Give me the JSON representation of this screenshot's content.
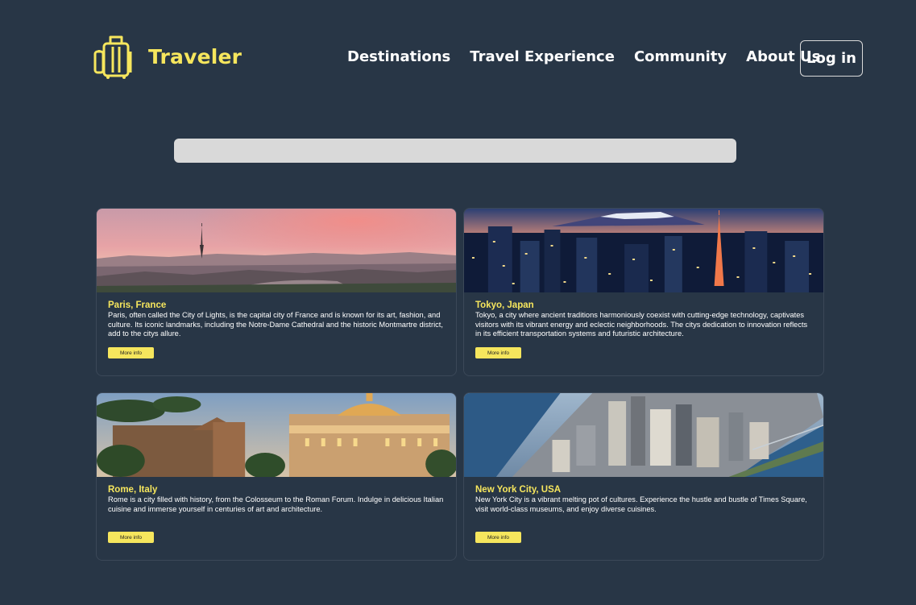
{
  "brand": {
    "name": "Traveler",
    "icon": "luggage-icon",
    "color": "#f6e65d"
  },
  "nav": {
    "destinations": "Destinations",
    "travel_experience": "Travel Experience",
    "community": "Community",
    "about_us": "About Us",
    "login": "Log in"
  },
  "search": {
    "value": "",
    "placeholder": ""
  },
  "colors": {
    "background": "#283646",
    "accent": "#f6e65d",
    "search_bg": "#d9d9d9"
  },
  "destinations": [
    {
      "title": "Paris, France",
      "description": "Paris, often called the City of Lights, is the capital city of France and is known for its art, fashion, and culture. Its iconic landmarks, including the Notre-Dame Cathedral and the historic Montmartre district, add to the citys allure.",
      "button": "More info"
    },
    {
      "title": "Tokyo, Japan",
      "description": "Tokyo, a city where ancient traditions harmoniously coexist with cutting-edge technology, captivates visitors with its vibrant energy and eclectic neighborhoods. The citys dedication to innovation reflects in its efficient transportation systems and futuristic architecture.",
      "button": "More info"
    },
    {
      "title": "Rome, Italy",
      "description": "Rome is a city filled with history, from the Colosseum to the Roman Forum. Indulge in delicious Italian cuisine and immerse yourself in centuries of art and architecture.",
      "button": "More info"
    },
    {
      "title": "New York City, USA",
      "description": "New York City is a vibrant melting pot of cultures. Experience the hustle and bustle of Times Square, visit world-class museums, and enjoy diverse cuisines.",
      "button": "More info"
    }
  ]
}
